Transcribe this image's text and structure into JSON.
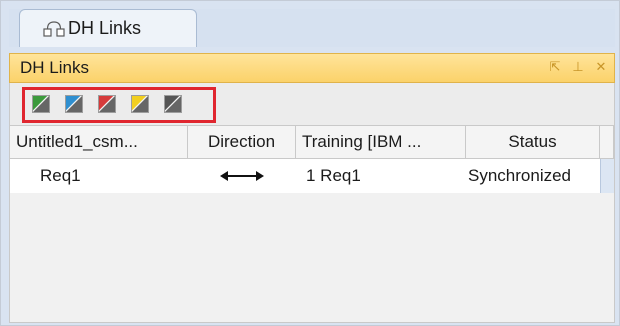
{
  "tab": {
    "label": "DH Links",
    "icon": "linked-nodes-icon"
  },
  "panel": {
    "title": "DH Links",
    "controls": [
      {
        "name": "undock-icon",
        "glyph": "⇱"
      },
      {
        "name": "pin-icon",
        "glyph": "⊥"
      },
      {
        "name": "close-icon",
        "glyph": "✕"
      }
    ]
  },
  "toolbar": {
    "buttons": [
      {
        "name": "green-link-button",
        "color": "#3c9a3c"
      },
      {
        "name": "blue-link-button",
        "color": "#2f8fd0"
      },
      {
        "name": "red-link-button",
        "color": "#d63b3b"
      },
      {
        "name": "yellow-link-button",
        "color": "#f2cf1f"
      },
      {
        "name": "gray-link-button",
        "color": "#555555"
      }
    ],
    "highlight_color": "#e0262f"
  },
  "table": {
    "columns": [
      "Untitled1_csm...",
      "Direction",
      "Training [IBM ...",
      "Status"
    ],
    "rows": [
      {
        "source": "Req1",
        "direction": "⟷",
        "target": "1 Req1",
        "status": "Synchronized"
      }
    ]
  }
}
